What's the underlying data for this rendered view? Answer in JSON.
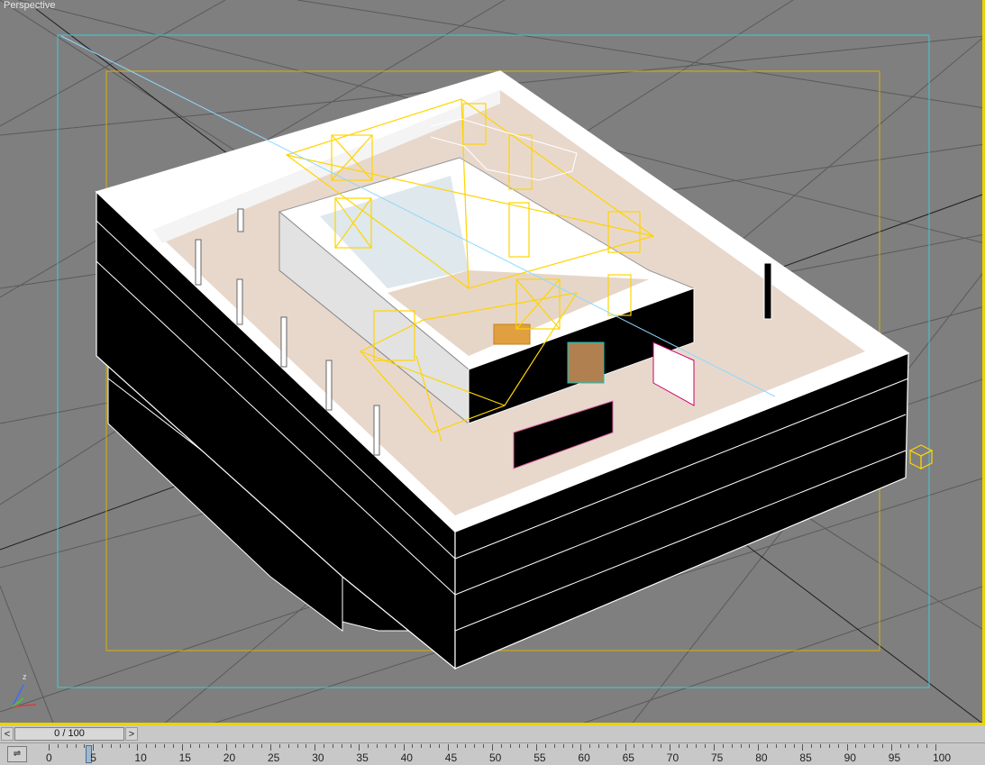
{
  "viewport": {
    "label": "Perspective",
    "axis": {
      "z": "z",
      "x": "x",
      "y": "y"
    }
  },
  "timeline": {
    "prev_label": "<",
    "next_label": ">",
    "slider_text": "0 / 100",
    "current_frame": 0,
    "ticks": [
      "0",
      "5",
      "10",
      "15",
      "20",
      "25",
      "30",
      "35",
      "40",
      "45",
      "50",
      "55",
      "60",
      "65",
      "70",
      "75",
      "80",
      "85",
      "90",
      "95",
      "100"
    ]
  },
  "colors": {
    "viewport_bg": "#7f7f7f",
    "active_border": "#e8d400",
    "safe_frame_outer": "#40c8d8",
    "safe_frame_inner": "#d8b000",
    "selection": "#ffd400"
  },
  "icons": {
    "track_toggle": "key-curve-icon",
    "camera_target": "cube-icon"
  }
}
